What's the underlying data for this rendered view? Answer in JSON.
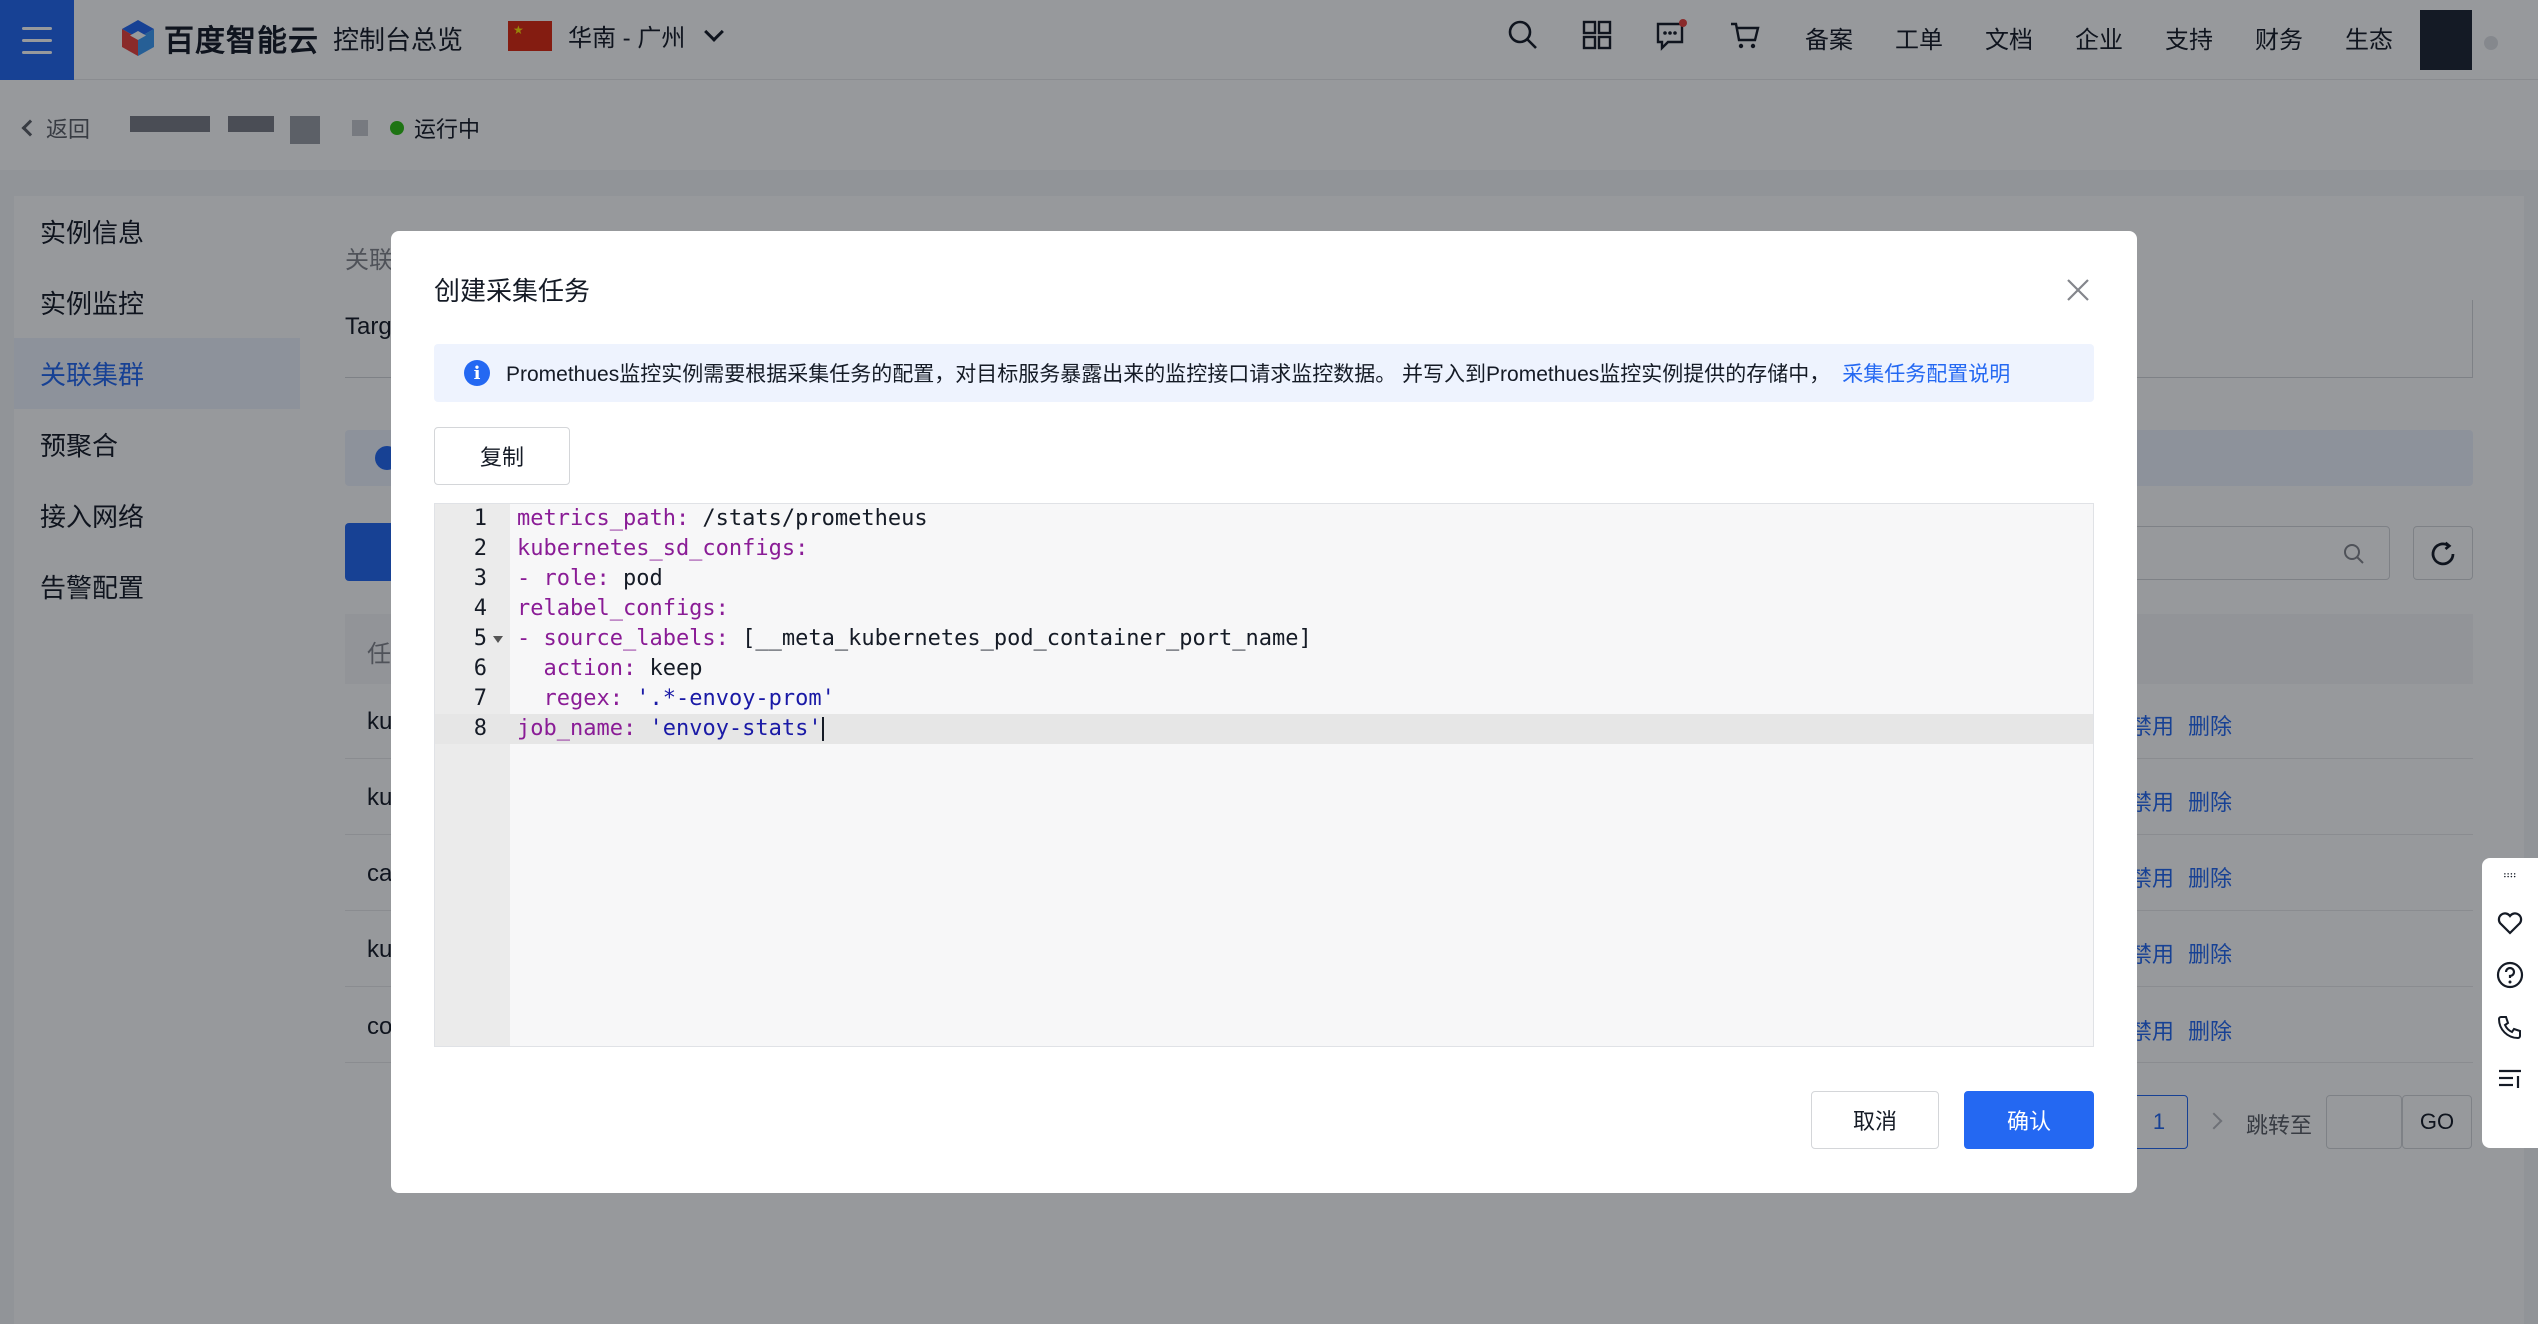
{
  "topbar": {
    "brand": "百度智能云",
    "console_title": "控制台总览",
    "region": "华南 - 广州",
    "links": [
      "备案",
      "工单",
      "文档",
      "企业",
      "支持",
      "财务",
      "生态"
    ],
    "icons": [
      "search-icon",
      "grid-icon",
      "message-icon",
      "cart-icon"
    ]
  },
  "subheader": {
    "back_label": "返回",
    "status_label": "运行中"
  },
  "sidebar": {
    "items": [
      {
        "label": "实例信息"
      },
      {
        "label": "实例监控"
      },
      {
        "label": "关联集群"
      },
      {
        "label": "预聚合"
      },
      {
        "label": "接入网络"
      },
      {
        "label": "告警配置"
      }
    ],
    "active_index": 2
  },
  "background": {
    "section_label_fragment": "关联",
    "target_fragment": "Targ",
    "table_header_fragment": "任",
    "rows": [
      {
        "name_fragment": "ku",
        "actions": [
          "禁用",
          "删除"
        ]
      },
      {
        "name_fragment": "ku",
        "actions": [
          "禁用",
          "删除"
        ]
      },
      {
        "name_fragment": "ca",
        "actions": [
          "禁用",
          "删除"
        ]
      },
      {
        "name_fragment": "ku",
        "actions": [
          "禁用",
          "删除"
        ]
      },
      {
        "name_fragment": "co",
        "actions": [
          "禁用",
          "删除"
        ]
      }
    ],
    "pagination": {
      "current_page": "1",
      "jump_label": "跳转至",
      "go_label": "GO"
    }
  },
  "modal": {
    "title": "创建采集任务",
    "info_text": "Promethues监控实例需要根据采集任务的配置，对目标服务暴露出来的监控接口请求监控数据。 并写入到Promethues监控实例提供的存储中，",
    "info_link": "采集任务配置说明",
    "copy_label": "复制",
    "cancel_label": "取消",
    "confirm_label": "确认",
    "code_lines": [
      {
        "num": "1",
        "key": "metrics_path:",
        "val": " /stats/prometheus",
        "indent": ""
      },
      {
        "num": "2",
        "key": "kubernetes_sd_configs:",
        "val": "",
        "indent": ""
      },
      {
        "num": "3",
        "key": "- role:",
        "val": " pod",
        "indent": ""
      },
      {
        "num": "4",
        "key": "relabel_configs:",
        "val": "",
        "indent": ""
      },
      {
        "num": "5",
        "key": "- source_labels:",
        "val": " [__meta_kubernetes_pod_container_port_name]",
        "indent": ""
      },
      {
        "num": "6",
        "key": "action:",
        "val": " keep",
        "indent": "  "
      },
      {
        "num": "7",
        "key": "regex:",
        "val": " '.*-envoy-prom'",
        "indent": "  "
      },
      {
        "num": "8",
        "key": "job_name:",
        "val": " 'envoy-stats'",
        "indent": ""
      }
    ]
  }
}
